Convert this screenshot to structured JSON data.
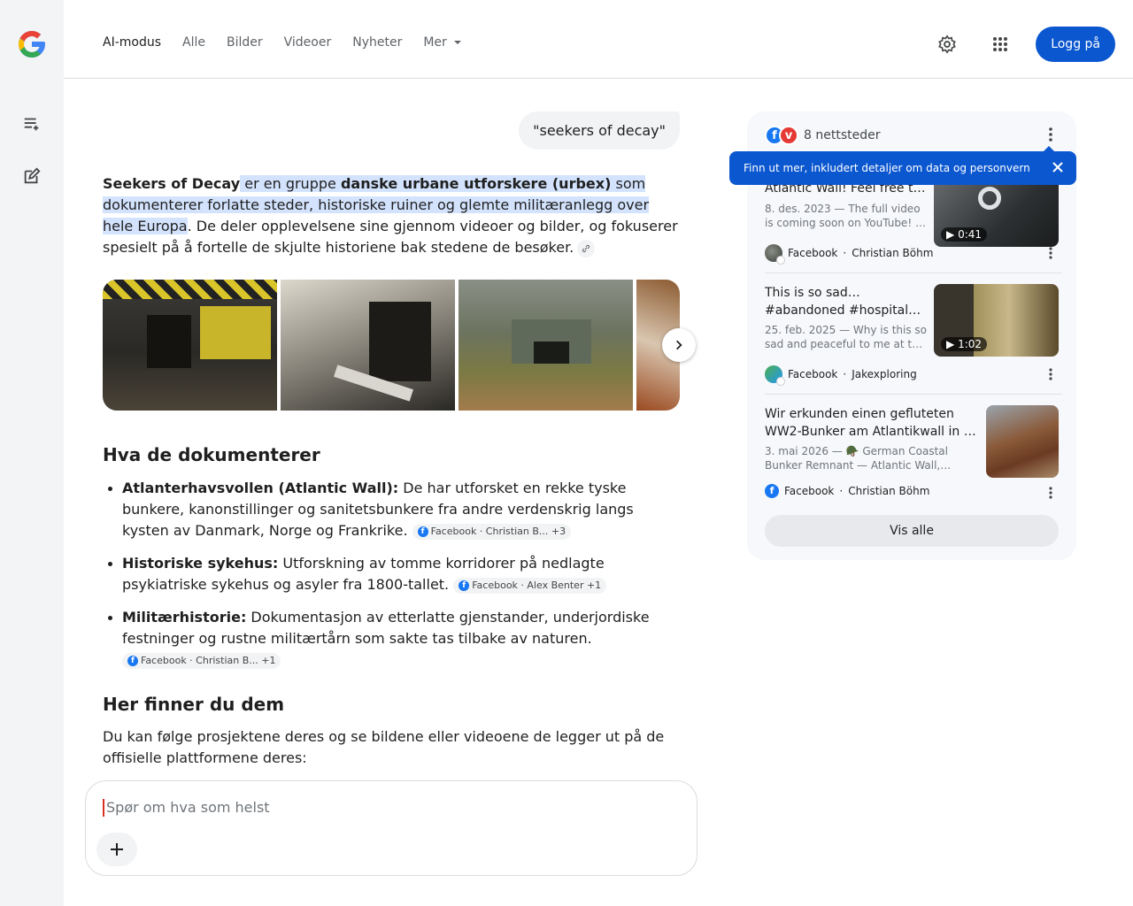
{
  "tabs": [
    {
      "label": "AI-modus",
      "active": true
    },
    {
      "label": "Alle"
    },
    {
      "label": "Bilder"
    },
    {
      "label": "Videoer"
    },
    {
      "label": "Nyheter"
    },
    {
      "label": "Mer",
      "dropdown": true
    }
  ],
  "header": {
    "login_label": "Logg på",
    "settings_icon": "gear-icon",
    "apps_icon": "apps-grid-icon"
  },
  "rail": {
    "history_icon": "history-list-icon",
    "new_chat_icon": "new-chat-icon"
  },
  "query": "\"seekers of decay\"",
  "answer": {
    "intro_bold": "Seekers of Decay",
    "intro_hl_1": " er en gruppe ",
    "intro_hl_bold": "danske urbane utforskere (urbex)",
    "intro_hl_2": " som dokumenterer forlatte steder, historiske ruiner og glemte militæranlegg over hele Europa",
    "intro_rest": ". De deler opplevelsene sine gjennom videoer og bilder, og fokuserer spesielt på å fortelle de skjulte historiene bak stedene de besøker."
  },
  "section1_title": "Hva de dokumenterer",
  "bullets": [
    {
      "title": "Atlanterhavsvollen (Atlantic Wall):",
      "text": " De har utforsket en rekke tyske bunkere, kanonstillinger og sanitetsbunkere fra andre verdenskrig langs kysten av Danmark, Norge og Frankrike.",
      "chip": "Facebook · Christian B... +3"
    },
    {
      "title": "Historiske sykehus:",
      "text": " Utforskning av tomme korridorer på nedlagte psykiatriske sykehus og asyler fra 1800-tallet.",
      "chip": "Facebook · Alex Benter +1"
    },
    {
      "title": "Militærhistorie:",
      "text": " Dokumentasjon av etterlatte gjenstander, underjordiske festninger og rustne militærtårn som sakte tas tilbake av naturen.",
      "chip": "Facebook · Christian B... +1"
    }
  ],
  "section2_title": "Her finner du dem",
  "section2_text": "Du kan følge prosjektene deres og se bildene eller videoene de legger ut på de offisielle plattformene deres:",
  "input_placeholder": "Spør om hva som helst",
  "panel": {
    "sites_label": "8 nettsteder",
    "tooltip": "Finn ut mer, inkludert detaljer om data og personvern",
    "cards": [
      {
        "title": "Atlantic Wall! Feel free t…",
        "snippet": "8. des. 2023 — The full video is coming soon on YouTube! …",
        "duration": "0:41",
        "source": "Facebook",
        "author": "Christian Böhm"
      },
      {
        "title": "This is so sad… #abandoned #hospital…",
        "snippet": "25. feb. 2025 — Why is this so sad and peaceful to me at t…",
        "duration": "1:02",
        "source": "Facebook",
        "author": "Jakexploring"
      },
      {
        "title": "Wir erkunden einen gefluteten WW2-Bunker am Atlantikwall in …",
        "snippet": "3. mai 2026 — 🪖 German Coastal Bunker Remnant — Atlantic Wall,…",
        "source": "Facebook",
        "author": "Christian Böhm"
      }
    ],
    "view_all": "Vis alle"
  },
  "colors": {
    "accent": "#0b57d0",
    "highlight": "#d3e3fd",
    "facebook": "#1877f2"
  }
}
